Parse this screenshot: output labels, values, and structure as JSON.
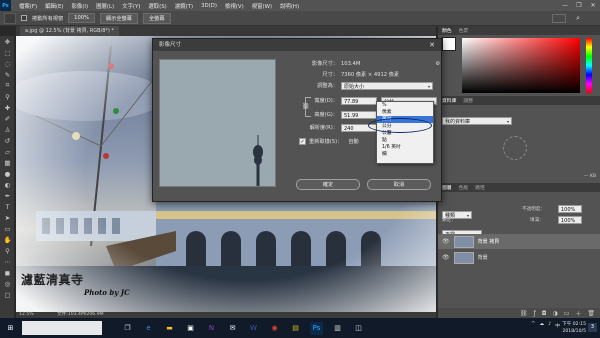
{
  "menubar": {
    "logo": "Ps",
    "items": [
      "檔案(F)",
      "編輯(E)",
      "影像(I)",
      "圖層(L)",
      "文字(Y)",
      "選取(S)",
      "濾鏡(T)",
      "3D(D)",
      "檢視(V)",
      "視窗(W)",
      "說明(H)"
    ],
    "window_controls": [
      "—",
      "❐",
      "✕"
    ]
  },
  "optbar": {
    "checkbox_label": "捲動所有視窗",
    "zoom_100": "100%",
    "fit_screen": "顯示全螢幕",
    "fill_screen": "全螢幕"
  },
  "document": {
    "tab_label": "a.jpg @ 12.5% (背景 拷貝, RGB/8*) *",
    "status_zoom": "12.5%",
    "status_doc": "文件:103.4M/206.9M",
    "watermark_title": "濾藍清真寺",
    "watermark_credit": "Photo by JC"
  },
  "dialog": {
    "title": "影像尺寸",
    "close": "✕",
    "image_size_label": "影像尺寸：",
    "image_size_value": "103.4M",
    "dims_label": "尺寸：",
    "dims_value": "7360 像素 × 4912 像素",
    "fit_label": "調整為：",
    "fit_value": "原始大小",
    "width_label": "寬度(D)：",
    "width_value": "77.89",
    "height_label": "高度(G)：",
    "height_value": "51.99",
    "res_label": "解析度(R)：",
    "res_value": "240",
    "resample_label": "重新取樣(S)：",
    "resample_value": "自動",
    "unit_value": "公分",
    "ok": "確定",
    "cancel": "取消"
  },
  "unit_menu": {
    "items": [
      "%",
      "像素",
      "英吋",
      "公分",
      "公釐",
      "點",
      "1/6 英吋",
      "欄"
    ],
    "selected_index": 2
  },
  "right_panel": {
    "color_tabs": [
      "顏色",
      "色票"
    ],
    "lib_tabs": [
      "資料庫",
      "調整"
    ],
    "lib_select": "我的資料庫",
    "layer_tabs": [
      "圖層",
      "色版",
      "路徑"
    ],
    "kind_label": "種類",
    "normal_label": "正常",
    "opacity_label": "不透明度：",
    "opacity_value": "100%",
    "lock_label": "鎖定：",
    "fill_label": "填滿：",
    "fill_value": "100%",
    "layers": [
      "背景 拷貝",
      "背景"
    ],
    "kb_label": "— KB"
  },
  "taskbar": {
    "time": "下午 02:15",
    "date": "2018/10/5",
    "ime": "中",
    "notif": "3"
  },
  "colors": {
    "accent": "#3875d7",
    "panel": "#535353",
    "taskbar": "#101a28",
    "callout": "#0a2a6b"
  }
}
